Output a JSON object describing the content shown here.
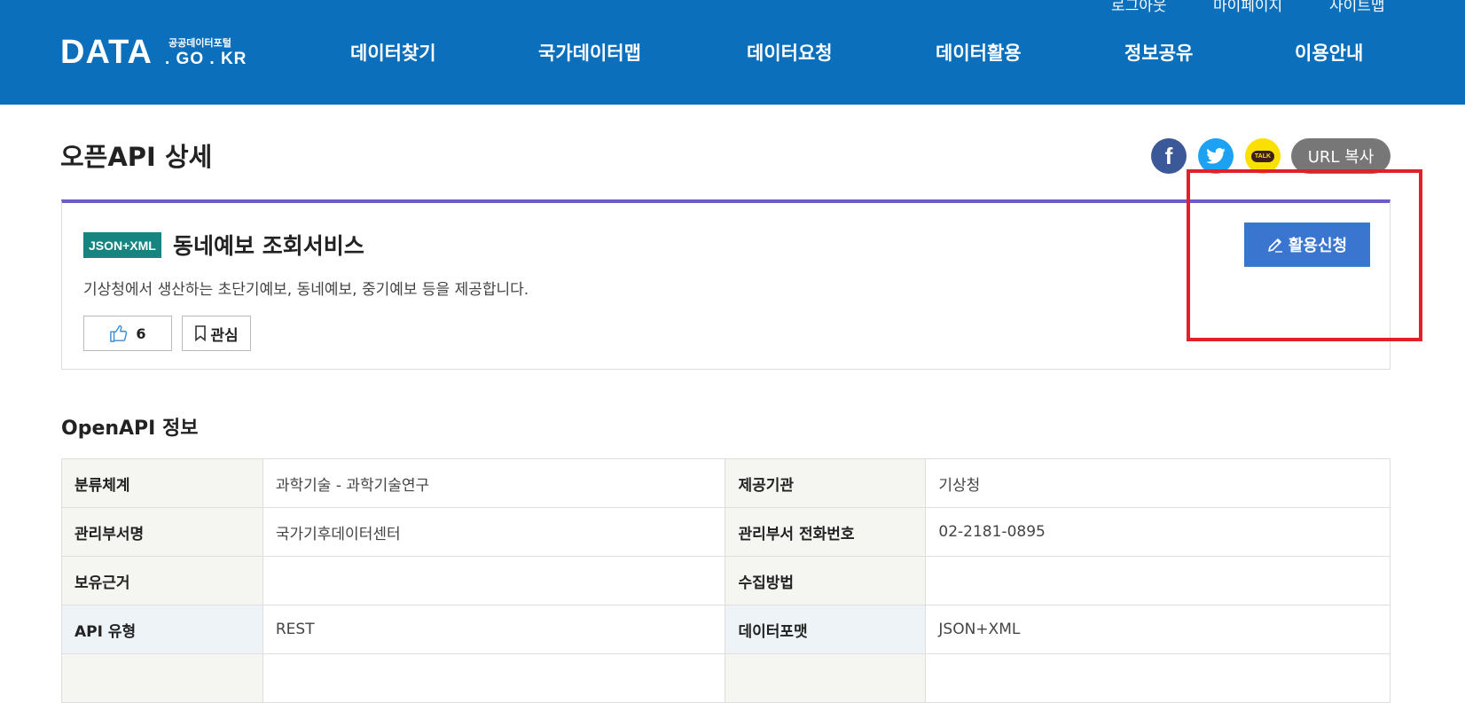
{
  "header": {
    "util_links": [
      "로그아웃",
      "마이페이지",
      "사이트맵"
    ],
    "logo": {
      "main": "DATA",
      "korean": "공공데이터포털",
      "sub": ". GO . KR"
    },
    "nav": [
      "데이터찾기",
      "국가데이터맵",
      "데이터요청",
      "데이터활용",
      "정보공유",
      "이용안내"
    ]
  },
  "page": {
    "title": "오픈API 상세",
    "share": {
      "facebook_icon": "f",
      "kakao_icon": "TALK",
      "url_copy_label": "URL 복사"
    }
  },
  "detail": {
    "format_badge": "JSON+XML",
    "service_title": "동네예보 조회서비스",
    "description": "기상청에서 생산하는 초단기예보, 동네예보, 중기예보 등을 제공합니다.",
    "like_count": "6",
    "favorite_label": "관심",
    "apply_label": "활용신청"
  },
  "info": {
    "title": "OpenAPI 정보",
    "rows": [
      {
        "l1": "분류체계",
        "v1": "과학기술 - 과학기술연구",
        "l2": "제공기관",
        "v2": "기상청"
      },
      {
        "l1": "관리부서명",
        "v1": "국가기후데이터센터",
        "l2": "관리부서 전화번호",
        "v2": "02-2181-0895"
      },
      {
        "l1": "보유근거",
        "v1": "",
        "l2": "수집방법",
        "v2": ""
      },
      {
        "l1": "API 유형",
        "v1": "REST",
        "l2": "데이터포맷",
        "v2": "JSON+XML"
      }
    ]
  },
  "colors": {
    "header_bg": "#0b6fbc",
    "accent_line": "#6b5bd0",
    "apply_button": "#3a76d0",
    "format_badge": "#16847f",
    "highlight_box": "#e32025"
  }
}
